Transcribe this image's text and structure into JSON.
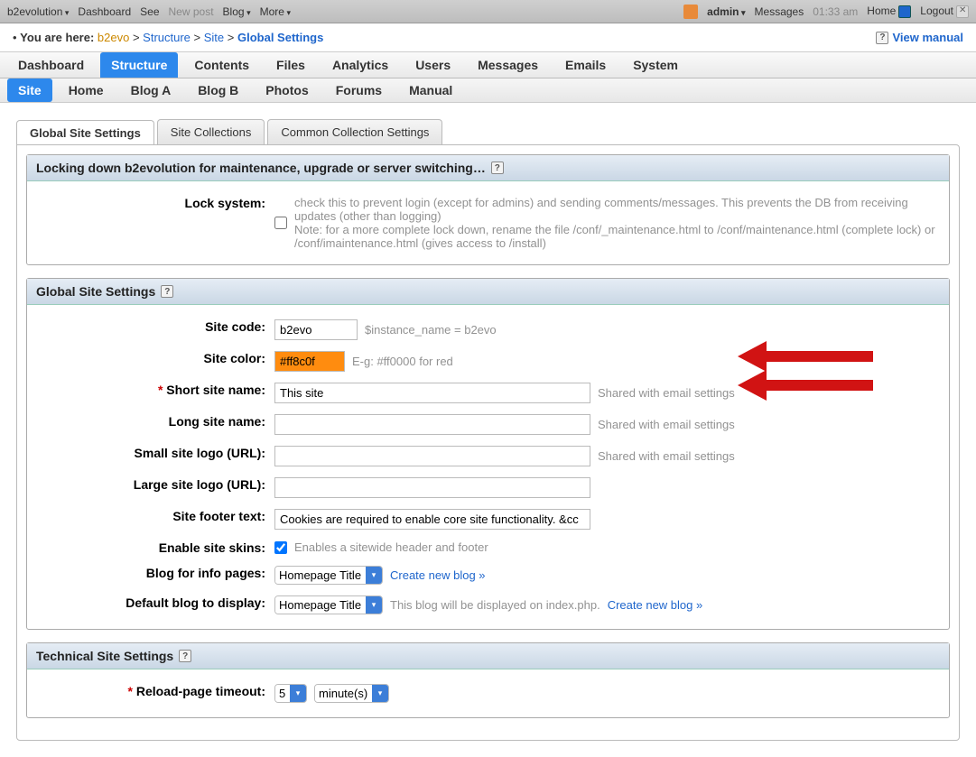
{
  "topbar": {
    "brand": "b2evolution",
    "items": [
      "Dashboard",
      "See",
      "New post",
      "Blog",
      "More"
    ],
    "admin": "admin",
    "messages": "Messages",
    "time": "01:33 am",
    "home": "Home",
    "logout": "Logout"
  },
  "breadcrumb": {
    "prefix": "You are here:",
    "b2evo": "b2evo",
    "structure": "Structure",
    "site": "Site",
    "current": "Global Settings",
    "view_manual": "View manual"
  },
  "maintabs": [
    "Dashboard",
    "Structure",
    "Contents",
    "Files",
    "Analytics",
    "Users",
    "Messages",
    "Emails",
    "System"
  ],
  "maintab_active": 1,
  "subtabs": [
    "Site",
    "Home",
    "Blog A",
    "Blog B",
    "Photos",
    "Forums",
    "Manual"
  ],
  "subtab_active": 0,
  "terttabs": [
    "Global Site Settings",
    "Site Collections",
    "Common Collection Settings"
  ],
  "terttab_active": 0,
  "block_lock": {
    "title": "Locking down b2evolution for maintenance, upgrade or server switching…",
    "label": "Lock system:",
    "hint1": "check this to prevent login (except for admins) and sending comments/messages. This prevents the DB from receiving updates (other than logging)",
    "hint2": "Note: for a more complete lock down, rename the file /conf/_maintenance.html to /conf/maintenance.html (complete lock) or /conf/imaintenance.html (gives access to /install)"
  },
  "block_global": {
    "title": "Global Site Settings",
    "fields": {
      "site_code_label": "Site code:",
      "site_code_value": "b2evo",
      "site_code_hint": "$instance_name = b2evo",
      "site_color_label": "Site color:",
      "site_color_value": "#ff8c0f",
      "site_color_hint": "E-g: #ff0000 for red",
      "short_name_label": "Short site name:",
      "short_name_value": "This site",
      "shared_hint": "Shared with email settings",
      "long_name_label": "Long site name:",
      "small_logo_label": "Small site logo (URL):",
      "large_logo_label": "Large site logo (URL):",
      "footer_label": "Site footer text:",
      "footer_value": "Cookies are required to enable core site functionality. &cc",
      "skins_label": "Enable site skins:",
      "skins_hint": "Enables a sitewide header and footer",
      "info_label": "Blog for info pages:",
      "info_option": "Homepage Title",
      "create_link": "Create new blog »",
      "default_label": "Default blog to display:",
      "default_hint": "This blog will be displayed on index.php."
    }
  },
  "block_tech": {
    "title": "Technical Site Settings",
    "reload_label": "Reload-page timeout:",
    "reload_value": "5",
    "reload_unit": "minute(s)"
  }
}
